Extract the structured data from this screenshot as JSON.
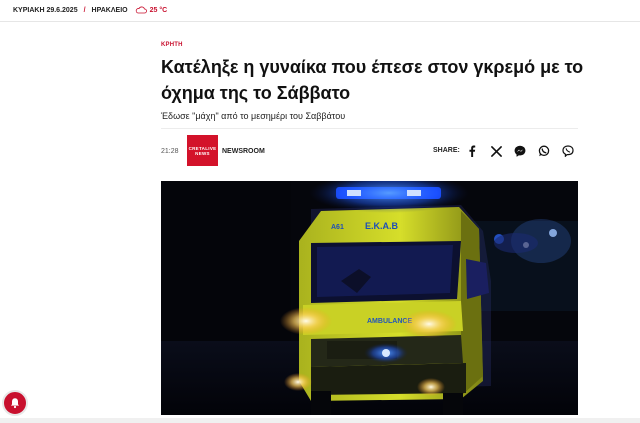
{
  "topbar": {
    "date": "ΚΥΡΙΑΚΗ 29.6.2025",
    "separator": "/",
    "city": "ΗΡΑΚΛΕΙΟ",
    "temperature": "25 °C",
    "weather_icon": "partly-cloudy-icon"
  },
  "article": {
    "category": "ΚΡΗΤΗ",
    "title": "Κατέληξε η γυναίκα που έπεσε στον γκρεμό με το όχημα της το Σάββατο",
    "subtitle": "Έδωσε \"μάχη\" από το μεσημέρι του Σαββάτου",
    "time": "21:28",
    "author": "NEWSROOM",
    "author_logo": {
      "line1": "CRETALIVE",
      "line2": "NEWS"
    },
    "share_label": "SHARE:",
    "share_icons": [
      "facebook-icon",
      "x-icon",
      "messenger-icon",
      "whatsapp-icon",
      "viber-icon"
    ],
    "photo": {
      "vehicle_text": "Ε.Κ.Α.Β",
      "number_text": "A61",
      "front_text": "AMBULANCE"
    }
  },
  "colors": {
    "accent": "#c8102e",
    "logo_bg": "#d3122a"
  }
}
